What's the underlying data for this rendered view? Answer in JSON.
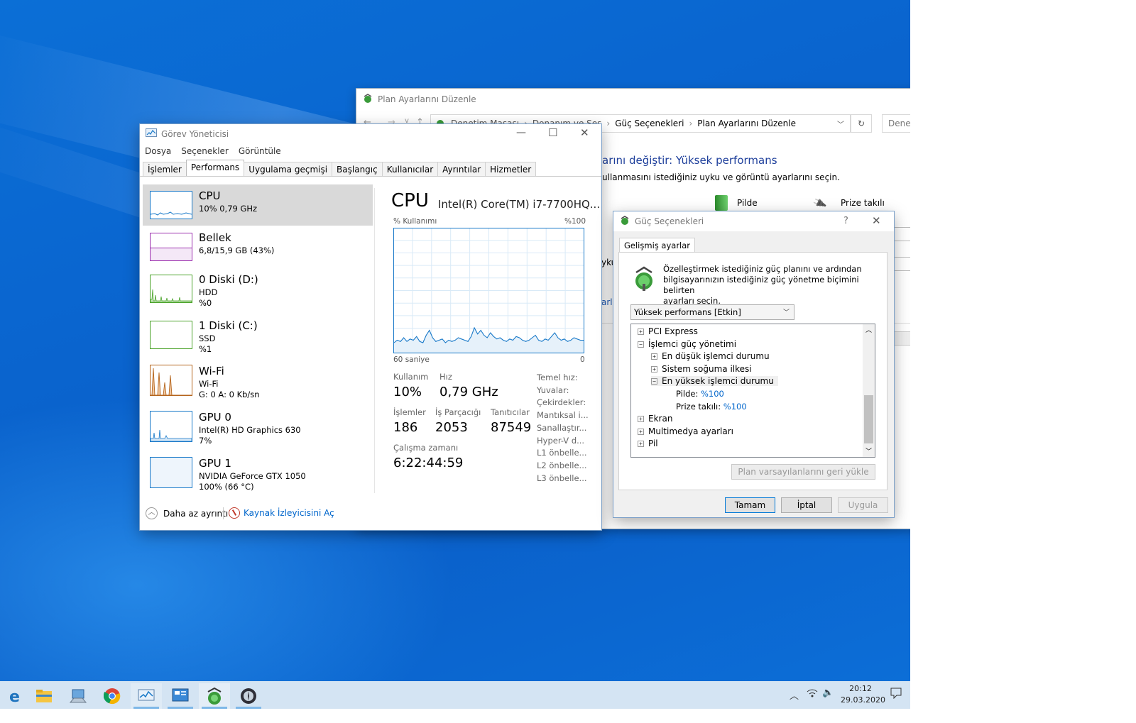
{
  "plan_window": {
    "title": "Plan Ayarlarını Düzenle",
    "breadcrumb": [
      "Denetim Masası",
      "Donanım ve Ses",
      "Güç Seçenekleri",
      "Plan Ayarlarını Düzenle"
    ],
    "search_placeholder": "Denet",
    "heading": "arını değiştir: Yüksek performans",
    "subheading": "ullanmasını istediğiniz uyku ve görüntü ayarlarını seçin.",
    "col_battery": "Pilde",
    "col_plugged": "Prize takılı",
    "left_fragment_1": "yku",
    "left_fragment_2": "arla"
  },
  "task_manager": {
    "title": "Görev Yöneticisi",
    "menu": [
      "Dosya",
      "Seçenekler",
      "Görüntüle"
    ],
    "tabs": [
      "İşlemler",
      "Performans",
      "Uygulama geçmişi",
      "Başlangıç",
      "Kullanıcılar",
      "Ayrıntılar",
      "Hizmetler"
    ],
    "active_tab": "Performans",
    "items": [
      {
        "title": "CPU",
        "lines": [
          "10% 0,79 GHz"
        ],
        "color": "#1778c8"
      },
      {
        "title": "Bellek",
        "lines": [
          "6,8/15,9 GB (43%)"
        ],
        "color": "#9b2fae"
      },
      {
        "title": "0 Diski (D:)",
        "lines": [
          "HDD",
          "%0"
        ],
        "color": "#4ba32a"
      },
      {
        "title": "1 Diski (C:)",
        "lines": [
          "SSD",
          "%1"
        ],
        "color": "#4ba32a"
      },
      {
        "title": "Wi-Fi",
        "lines": [
          "Wi-Fi",
          "G: 0 A: 0 Kb/sn"
        ],
        "color": "#b5651d"
      },
      {
        "title": "GPU 0",
        "lines": [
          "Intel(R) HD Graphics 630",
          "7%"
        ],
        "color": "#1778c8"
      },
      {
        "title": "GPU 1",
        "lines": [
          "NVIDIA GeForce GTX 1050",
          "100% (66 °C)"
        ],
        "color": "#1778c8"
      }
    ],
    "detail": {
      "heading": "CPU",
      "model": "Intel(R) Core(TM) i7-7700HQ...",
      "usage_label": "% Kullanımı",
      "max_label": "%100",
      "time_label": "60 saniye",
      "zero_label": "0",
      "stats": {
        "usage_label": "Kullanım",
        "usage": "10%",
        "speed_label": "Hız",
        "speed": "0,79 GHz",
        "proc_label": "İşlemler",
        "proc": "186",
        "threads_label": "İş Parçacığı",
        "threads": "2053",
        "handles_label": "Tanıtıcılar",
        "handles": "87549",
        "uptime_label": "Çalışma zamanı",
        "uptime": "6:22:44:59"
      },
      "specs": [
        "Temel hız:",
        "Yuvalar:",
        "Çekirdekler:",
        "Mantıksal i...",
        "Sanallaştır...",
        "Hyper-V d...",
        "L1 önbelle...",
        "L2 önbelle...",
        "L3 önbelle..."
      ]
    },
    "footer_less": "Daha az ayrıntı",
    "footer_monitor": "Kaynak İzleyicisini Aç"
  },
  "cpu_graph": {
    "range": [
      0,
      100
    ],
    "samples": [
      8,
      10,
      9,
      12,
      9,
      11,
      10,
      13,
      9,
      8,
      14,
      18,
      12,
      9,
      10,
      11,
      8,
      10,
      9,
      10,
      12,
      11,
      10,
      9,
      13,
      20,
      15,
      18,
      14,
      12,
      16,
      13,
      11,
      12,
      10,
      9,
      11,
      10,
      13,
      12,
      10,
      9,
      10,
      12,
      14,
      10,
      9,
      11,
      10,
      13,
      16,
      12,
      10,
      11,
      9,
      10,
      12,
      11,
      10,
      10
    ]
  },
  "power_dialog": {
    "title": "Güç Seçenekleri",
    "help": "?",
    "tab": "Gelişmiş ayarlar",
    "description": [
      "Özelleştirmek istediğiniz güç planını ve ardından",
      "bilgisayarınızın istediğiniz güç yönetme biçimini belirten",
      "ayarları seçin."
    ],
    "plan_selected": "Yüksek performans [Etkin]",
    "tree": [
      {
        "label": "PCI Express",
        "level": 0,
        "expander": "+"
      },
      {
        "label": "İşlemci güç yönetimi",
        "level": 0,
        "expander": "−"
      },
      {
        "label": "En düşük işlemci durumu",
        "level": 1,
        "expander": "+"
      },
      {
        "label": "Sistem soğuma ilkesi",
        "level": 1,
        "expander": "+"
      },
      {
        "label": "En yüksek işlemci durumu",
        "level": 1,
        "expander": "−"
      },
      {
        "label": "Pilde:",
        "level": 2,
        "value": "%100"
      },
      {
        "label": "Prize takılı:",
        "level": 2,
        "value": "%100"
      },
      {
        "label": "Ekran",
        "level": 0,
        "expander": "+"
      },
      {
        "label": "Multimedya ayarları",
        "level": 0,
        "expander": "+"
      },
      {
        "label": "Pil",
        "level": 0,
        "expander": "+"
      }
    ],
    "restore_button": "Plan varsayılanlarını geri yükle",
    "ok": "Tamam",
    "cancel": "İptal",
    "apply": "Uygula"
  },
  "taskbar": {
    "time": "20:12",
    "date": "29.03.2020",
    "icons": [
      "edge-icon",
      "file-explorer-icon",
      "computer-icon",
      "chrome-icon",
      "task-manager-icon",
      "control-panel-icon",
      "power-options-icon",
      "app-icon"
    ]
  }
}
